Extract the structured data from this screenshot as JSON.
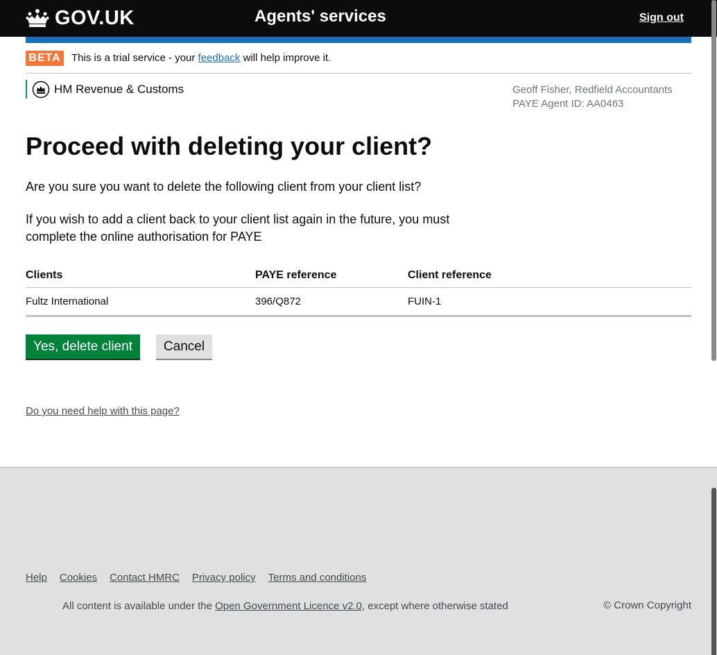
{
  "header": {
    "logo_text": "GOV.UK",
    "service_name": "Agents' services",
    "sign_out": "Sign out"
  },
  "beta": {
    "tag": "BETA",
    "message_before": "This is a trial service - your ",
    "link": "feedback",
    "message_after": " will help improve it."
  },
  "hmrc": {
    "name": "HM Revenue & Customs"
  },
  "agent": {
    "name": "Geoff Fisher, Redfield Accountants",
    "id_line": "PAYE Agent ID: AA0463"
  },
  "main": {
    "title": "Proceed with deleting your client?",
    "question": "Are you sure you want to delete the following client from your client list?",
    "note": "If you wish to add a client back to your client list again in the future, you must complete the online authorisation for PAYE"
  },
  "table": {
    "headers": [
      "Clients",
      "PAYE reference",
      "Client reference"
    ],
    "rows": [
      [
        "Fultz International",
        "396/Q872",
        "FUIN-1"
      ]
    ]
  },
  "actions": {
    "confirm": "Yes, delete client",
    "cancel": "Cancel"
  },
  "help_link": "Do you need help with this page?",
  "footer": {
    "links": [
      "Help",
      "Cookies",
      "Contact HMRC",
      "Privacy policy",
      "Terms and conditions"
    ],
    "licence_before": "All content is available under the ",
    "licence_link": "Open Government Licence v2.0",
    "licence_after": ", except where otherwise stated",
    "copyright": "© Crown Copyright"
  },
  "colors": {
    "header_bg": "#0b0c0c",
    "blue_bar": "#1d70b8",
    "beta_tag": "#f47738",
    "primary_button": "#00823b",
    "footer_bg": "#dee0e2"
  }
}
